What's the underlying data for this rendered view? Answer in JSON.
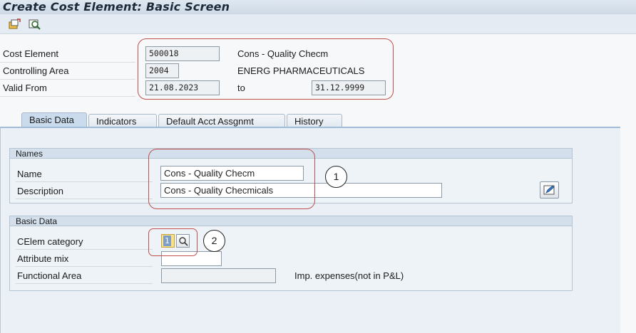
{
  "window": {
    "title": "Create Cost Element: Basic Screen"
  },
  "toolbar": {
    "icons": [
      "create-icon",
      "display-icon"
    ]
  },
  "header": {
    "cost_element_label": "Cost Element",
    "cost_element_value": "500018",
    "cost_element_desc": "Cons - Quality Checm",
    "controlling_area_label": "Controlling Area",
    "controlling_area_value": "2004",
    "controlling_area_desc": "ENERG PHARMACEUTICALS",
    "valid_from_label": "Valid From",
    "valid_from_value": "21.08.2023",
    "to_label": "to",
    "valid_to_value": "31.12.9999"
  },
  "tabs": [
    {
      "label": "Basic Data",
      "active": true
    },
    {
      "label": "Indicators",
      "active": false
    },
    {
      "label": "Default Acct Assgnmt",
      "active": false
    },
    {
      "label": "History",
      "active": false
    }
  ],
  "names_group": {
    "title": "Names",
    "name_label": "Name",
    "name_value": "Cons - Quality Checm",
    "description_label": "Description",
    "description_value": "Cons - Quality Checmicals"
  },
  "basic_data_group": {
    "title": "Basic Data",
    "celem_category_label": "CElem category",
    "celem_category_value": "1",
    "attribute_mix_label": "Attribute mix",
    "attribute_mix_value": "",
    "functional_area_label": "Functional Area",
    "functional_area_value": "",
    "category_description": "Imp. expenses(not in P&L)"
  },
  "callouts": [
    "1",
    "2"
  ],
  "colors": {
    "annotation_red": "#c0504d",
    "tab_active": "#c9dbec"
  }
}
